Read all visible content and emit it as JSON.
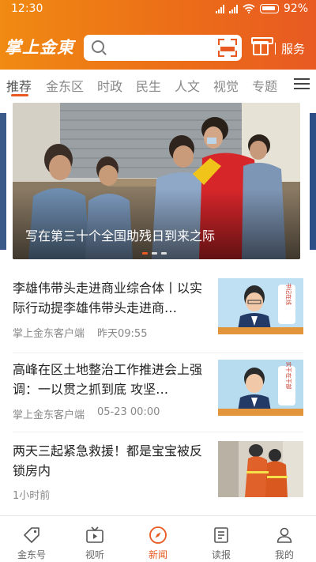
{
  "status": {
    "time": "12:30",
    "battery": "92%"
  },
  "header": {
    "logo": "掌上金東",
    "service_label": "服务",
    "search_placeholder": ""
  },
  "tabs": [
    {
      "label": "推荐"
    },
    {
      "label": "金东区"
    },
    {
      "label": "时政"
    },
    {
      "label": "民生"
    },
    {
      "label": "人文"
    },
    {
      "label": "视觉"
    },
    {
      "label": "专题"
    }
  ],
  "active_tab": "推荐",
  "banner": {
    "caption": "写在第三十个全国助残日到来之际",
    "slide_count": 3,
    "active_slide": 1
  },
  "news": [
    {
      "title": "李雄伟带头走进商业综合体丨以实际行动提李雄伟带头走进商…",
      "source": "掌上金东客户端",
      "time": "昨天09:55",
      "thumb_caption": "书记在线"
    },
    {
      "title": "高峰在区土地整治工作推进会上强调：一以贯之抓到底  攻坚…",
      "source": "掌上金东客户端",
      "time": "05-23  00:00",
      "thumb_caption": "实干在干部"
    },
    {
      "title": "两天三起紧急救援！都是宝宝被反锁房内",
      "source": "",
      "time": "1小时前",
      "thumb_caption": ""
    }
  ],
  "bottom_nav": [
    {
      "label": "金东号",
      "icon": "tag-icon"
    },
    {
      "label": "视听",
      "icon": "tv-icon"
    },
    {
      "label": "新闻",
      "icon": "compass-icon"
    },
    {
      "label": "读报",
      "icon": "newspaper-icon"
    },
    {
      "label": "我的",
      "icon": "user-icon"
    }
  ],
  "active_nav": "新闻",
  "colors": {
    "accent": "#e85a22",
    "header_start": "#f08a12",
    "header_end": "#e85a22"
  }
}
